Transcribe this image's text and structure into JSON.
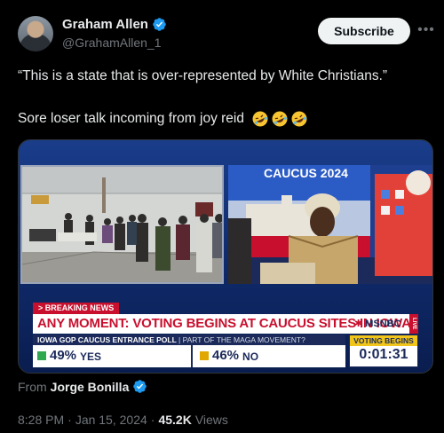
{
  "author": {
    "display_name": "Graham Allen",
    "handle": "@GrahamAllen_1"
  },
  "header": {
    "subscribe_label": "Subscribe",
    "more_icon": "more-horizontal-icon"
  },
  "tweet": {
    "line1": "“This is a state that is over-represented by White Christians.”",
    "line2": "Sore loser talk incoming from joy reid"
  },
  "media": {
    "breaking_label": "> BREAKING NEWS",
    "headline": "ANY MOMENT: VOTING BEGINS AT CAUCUS SITES IN IOWA",
    "network": "MSNBC",
    "live_label": "LIVE",
    "poll_title": "IOWA GOP CAUCUS ENTRANCE POLL",
    "poll_subtitle": "| PART OF THE MAGA MOVEMENT?",
    "yes_pct": "49%",
    "yes_label": "YES",
    "no_pct": "46%",
    "no_label": "NO",
    "timer_label": "VOTING BEGINS",
    "timer_value": "0:01:31",
    "wall_text": "CAUCUS 2024"
  },
  "attribution": {
    "prefix": "From",
    "source_name": "Jorge Bonilla"
  },
  "meta": {
    "time": "8:28 PM",
    "date": "Jan 15, 2024",
    "views_count": "45.2K",
    "views_label": "Views",
    "separator": "·"
  },
  "colors": {
    "verified": "#1d9bf0",
    "breaking_red": "#c8102e",
    "yes_green": "#2fa84f",
    "no_gold": "#e0a800",
    "muted": "#71767b"
  }
}
